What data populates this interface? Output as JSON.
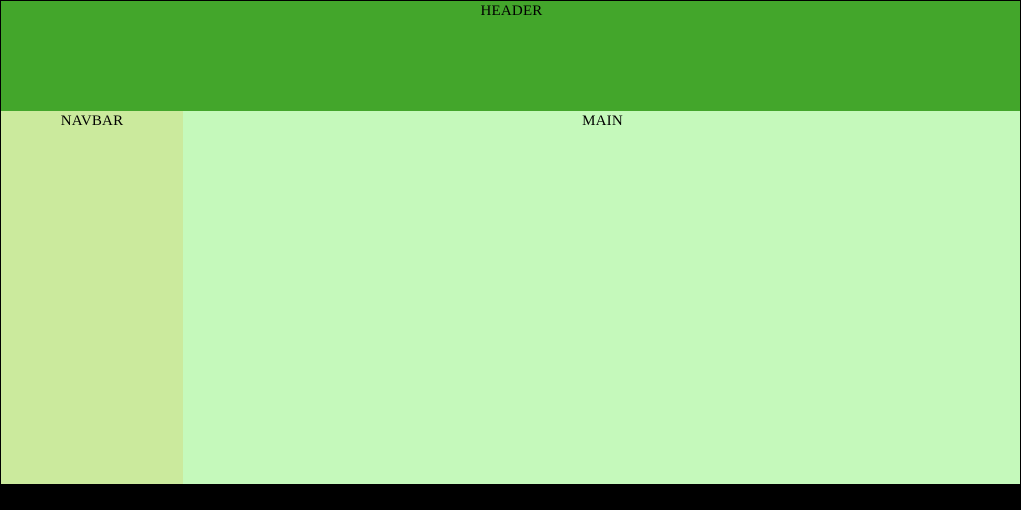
{
  "header": {
    "label": "HEADER",
    "color": "#43a62b"
  },
  "navbar": {
    "label": "NAVBAR",
    "color": "#cbea9d"
  },
  "main": {
    "label": "MAIN",
    "color": "#c5f9bb"
  },
  "footer": {
    "color": "#000000"
  }
}
